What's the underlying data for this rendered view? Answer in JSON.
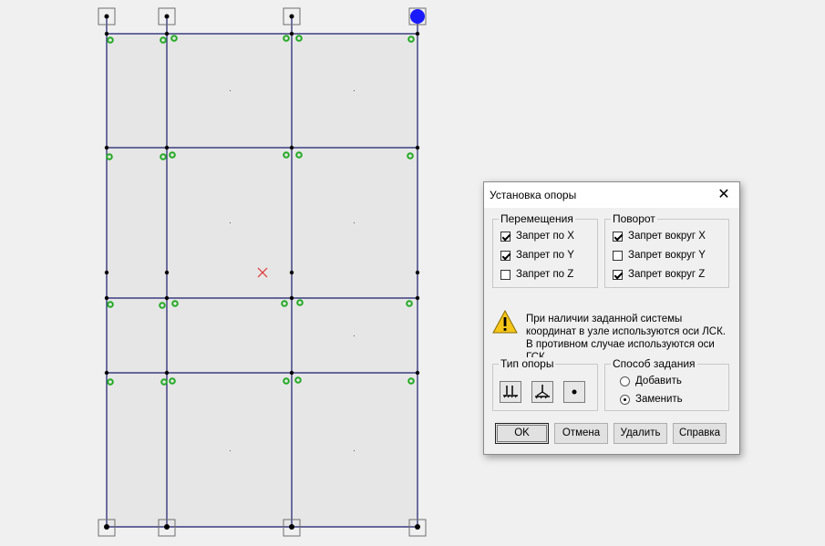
{
  "dialog": {
    "title": "Установка опоры",
    "close_icon": "close-icon",
    "displacements": {
      "legend": "Перемещения",
      "items": [
        {
          "label": "Запрет по X",
          "checked": true
        },
        {
          "label": "Запрет по Y",
          "checked": true
        },
        {
          "label": "Запрет по Z",
          "checked": false
        }
      ]
    },
    "rotation": {
      "legend": "Поворот",
      "items": [
        {
          "label": "Запрет вокруг X",
          "checked": true
        },
        {
          "label": "Запрет вокруг Y",
          "checked": false
        },
        {
          "label": "Запрет вокруг Z",
          "checked": true
        }
      ]
    },
    "info": {
      "icon": "warning-icon",
      "text": "При наличии заданной системы координат в узле используются оси ЛСК. В противном случае используются оси ГСК."
    },
    "support_type": {
      "legend": "Тип опоры",
      "buttons": [
        "fixed-support-icon",
        "pinned-support-icon",
        "node-support-icon"
      ]
    },
    "method": {
      "legend": "Способ задания",
      "options": [
        {
          "label": "Добавить",
          "checked": false
        },
        {
          "label": "Заменить",
          "checked": true
        }
      ]
    },
    "buttons": {
      "ok": "OK",
      "cancel": "Отмена",
      "delete": "Удалить",
      "help": "Справка"
    }
  },
  "model": {
    "columns": 4,
    "rows": 5,
    "colors": {
      "background": "#f0f0f0",
      "panel": "#e6e6e6",
      "beam": "#1a1a6e",
      "node": "#000000",
      "support_marker": "#22aa22",
      "selected_node": "#1a1aff",
      "cursor_mark": "#e03030"
    }
  }
}
